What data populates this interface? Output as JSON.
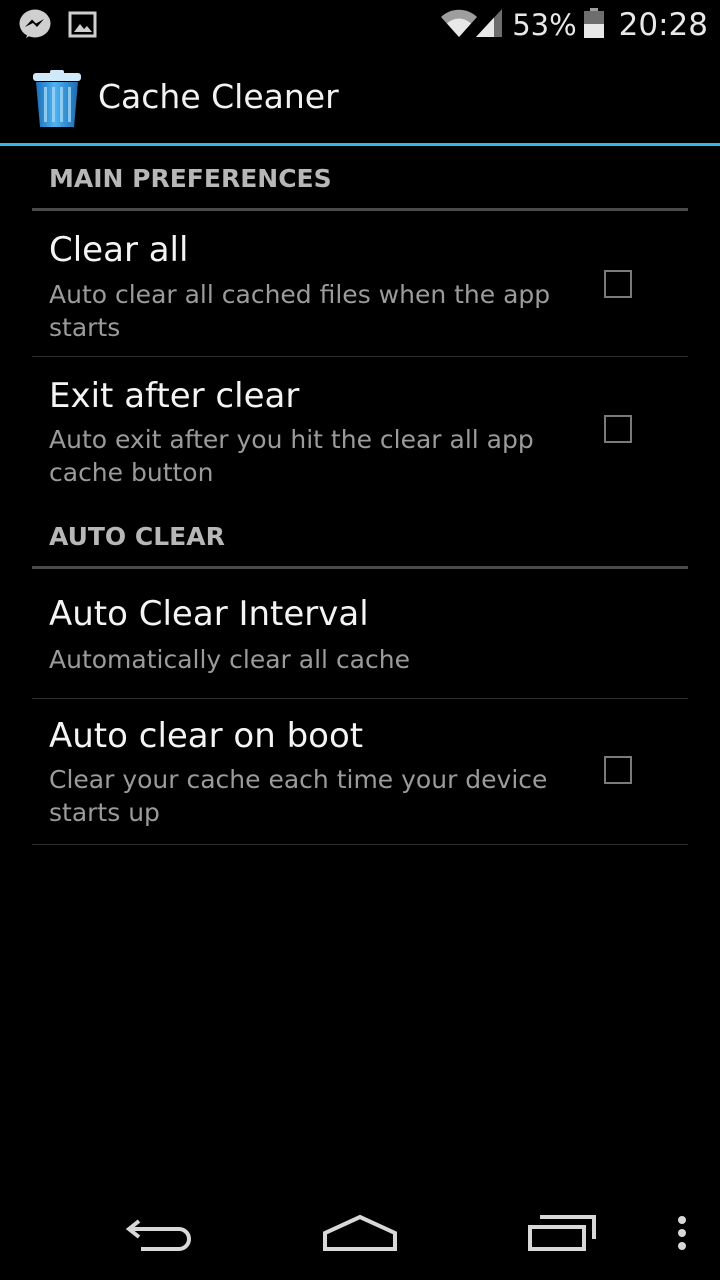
{
  "status_bar": {
    "left_icons": [
      "messenger-icon",
      "image-icon"
    ],
    "right_icons": [
      "wifi-icon",
      "signal-icon",
      "battery-icon"
    ],
    "battery_percent": "53%",
    "time": "20:28"
  },
  "action_bar": {
    "app_icon": "trash-can-icon",
    "title": "Cache Cleaner",
    "accent_color": "#33b5e5"
  },
  "preferences": {
    "main_category": "MAIN PREFERENCES",
    "clear_all": {
      "title": "Clear all",
      "summary": "Auto clear all cached files when the app starts",
      "checked": false
    },
    "exit_after_clear": {
      "title": "Exit after clear",
      "summary": "Auto exit after you hit the clear all app cache button",
      "checked": false
    },
    "auto_clear_category": "AUTO CLEAR",
    "auto_clear_interval": {
      "title": "Auto Clear Interval",
      "summary": "Automatically clear all cache"
    },
    "auto_clear_on_boot": {
      "title": "Auto clear on boot",
      "summary": "Clear your cache each time your device starts up",
      "checked": false
    }
  },
  "nav_bar": {
    "buttons": [
      "back-icon",
      "home-icon",
      "recent-apps-icon",
      "overflow-menu-icon"
    ]
  }
}
